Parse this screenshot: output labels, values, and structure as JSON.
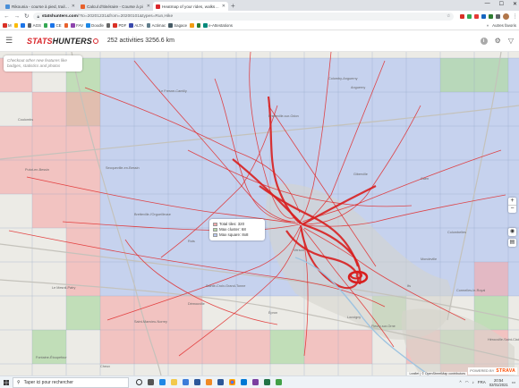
{
  "browser": {
    "tabs": [
      {
        "title": "Rikounia - course à pied, trail, ro",
        "color": "#4a8fd8",
        "active": false
      },
      {
        "title": "Calcul d'itinéraire - Course à pi",
        "color": "#e8612c",
        "active": false
      },
      {
        "title": "Heatmap of your rides, walks, ru",
        "color": "#d9262b",
        "active": true
      }
    ],
    "new_tab": "+",
    "url_host": "statshunters.com",
    "url_path": "/?to=20201231&from=20200101&types=Run,Hike",
    "bookmarks": [
      {
        "label": "M",
        "color": "#d93025"
      },
      {
        "label": "",
        "color": "#fbbc04"
      },
      {
        "label": "",
        "color": "#1a73e8"
      },
      {
        "label": "AGS",
        "color": "#5f6368"
      },
      {
        "label": "",
        "color": "#34a853"
      },
      {
        "label": "CE",
        "color": "#1a73e8"
      },
      {
        "label": "",
        "color": "#e8612c"
      },
      {
        "label": "FAV",
        "color": "#8e44ad"
      },
      {
        "label": "Doodle",
        "color": "#1e88e5"
      },
      {
        "label": "",
        "color": "#666666"
      },
      {
        "label": "PDF",
        "color": "#d93025"
      },
      {
        "label": "ALTA",
        "color": "#3949ab"
      },
      {
        "label": "Actimac",
        "color": "#607d8b"
      },
      {
        "label": "Sagace",
        "color": "#455a64"
      },
      {
        "label": "",
        "color": "#f39c12"
      },
      {
        "label": "",
        "color": "#2e7d32"
      },
      {
        "label": "e-Attestations",
        "color": "#00897b"
      }
    ],
    "other_favorites": "Autres favoris"
  },
  "app": {
    "logo_part1": "STATS",
    "logo_part2": "HUNTERS",
    "activities_summary": "252 activities 3256.6 km",
    "callout": "Checkout other new features like badges, statistics and photos"
  },
  "map": {
    "legend": {
      "total_tiles": "Total tiles: 320",
      "max_cluster": "Max cluster: 68",
      "max_square": "Max square: 8x8",
      "colors": {
        "tiles": "#f7a8a8",
        "cluster": "#b3d9a8",
        "square": "#b9c9f0"
      }
    },
    "zoom_in": "+",
    "zoom_out": "−",
    "attribution": "Leaflet | © OpenStreetMap contributors",
    "powered_by": "POWERED BY",
    "strava": "STRAVA",
    "place_labels": [
      "Le Fresne-Camilly",
      "Colomby-Anguerny",
      "Anguerny",
      "Coulombs",
      "Secqueville-en-Bessin",
      "Bretteville-l'Orgueilleuse",
      "Rots",
      "Saint-Manvieu-Norrey",
      "Cheux",
      "Fontaine-Étoupefour",
      "Le Mesnil-Patry",
      "Putot-en-Bessin",
      "Sainte-Croix-Grand-Tonne",
      "Verson",
      "Caen",
      "Hérouville-Saint-Clair",
      "Mondeville",
      "Colombelles",
      "Giberville",
      "Épron",
      "Louvigny",
      "Fleury-sur-Orne",
      "Ifs",
      "Cormelles-le-Royal",
      "Démouville",
      "Bretteville-sur-Odon",
      "Villons-les-Buissons"
    ]
  },
  "taskbar": {
    "search_placeholder": "Taper ici pour rechercher",
    "time": "20:54",
    "date": "02/01/2021",
    "lang": "FRA"
  }
}
